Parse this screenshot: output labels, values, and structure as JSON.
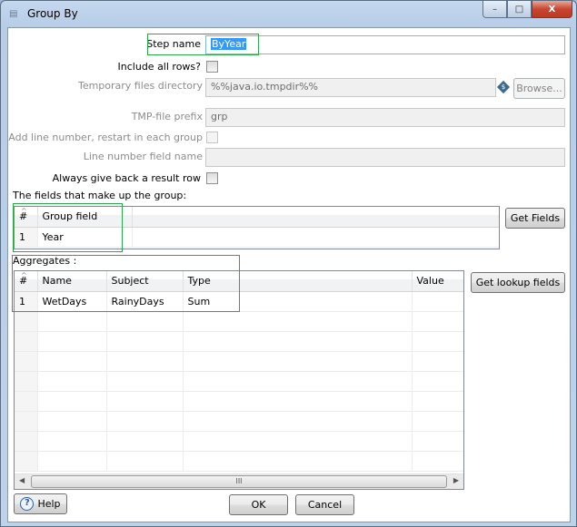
{
  "window": {
    "title": "Group By",
    "icon": "group-by-step-icon",
    "controls": {
      "minimize": "–",
      "maximize": "□",
      "close": "X"
    }
  },
  "form": {
    "step_name": {
      "label": "Step name",
      "value": "ByYear"
    },
    "include_all_rows": {
      "label": "Include all rows?",
      "checked": false
    },
    "temp_dir": {
      "label": "Temporary files directory",
      "value": "%%java.io.tmpdir%%",
      "variable_icon": "$",
      "browse_label": "Browse..."
    },
    "tmp_prefix": {
      "label": "TMP-file prefix",
      "value": "grp"
    },
    "add_line_number": {
      "label": "Add line number, restart in each group",
      "checked": false
    },
    "line_number_field": {
      "label": "Line number field name",
      "value": ""
    },
    "always_result_row": {
      "label": "Always give back a result row",
      "checked": false
    }
  },
  "group_section": {
    "title": "The fields that make up the group:",
    "columns": [
      "#",
      "Group field"
    ],
    "rows": [
      {
        "num": "1",
        "field": "Year"
      }
    ],
    "get_fields_label": "Get Fields"
  },
  "aggregates_section": {
    "title": "Aggregates :",
    "columns": [
      "#",
      "Name",
      "Subject",
      "Type",
      "Value"
    ],
    "rows": [
      {
        "num": "1",
        "name": "WetDays",
        "subject": "RainyDays",
        "type": "Sum",
        "value": ""
      }
    ],
    "get_lookup_label": "Get lookup fields",
    "scroll_thumb": "III"
  },
  "footer": {
    "help_label": "Help",
    "ok_label": "OK",
    "cancel_label": "Cancel"
  }
}
